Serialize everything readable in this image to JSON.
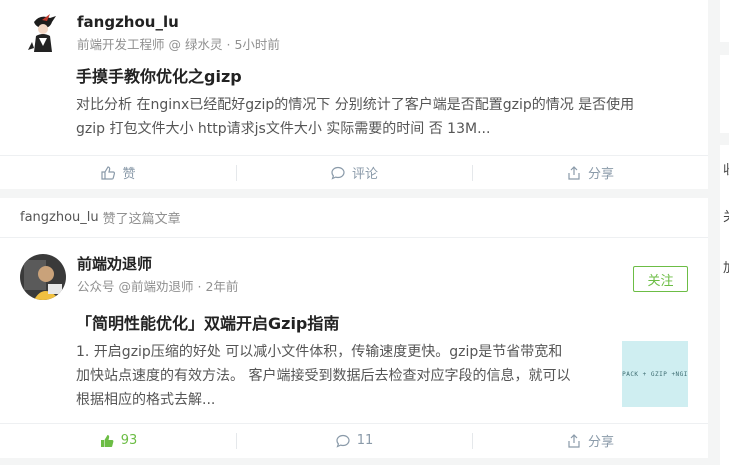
{
  "post1": {
    "author": "fangzhou_lu",
    "role": "前端开发工程师 @ 绿水灵",
    "time": "5小时前",
    "title": "手摸手教你优化之gizp",
    "summary_line1": "对比分析 在nginx已经配好gzip的情况下 分别统计了客户端是否配置gzip的情况 是否使用",
    "summary_line2": "gzip 打包文件大小 http请求js文件大小 实际需要的时间 否 13M...",
    "like_label": "赞",
    "comment_label": "评论",
    "share_label": "分享"
  },
  "activity": {
    "user": "fangzhou_lu",
    "action": "赞了这篇文章"
  },
  "post2": {
    "author": "前端劝退师",
    "role": "公众号 @前端劝退师",
    "time": "2年前",
    "follow_label": "关注",
    "title": "「简明性能优化」双端开启Gzip指南",
    "summary_line1": "1. 开启gzip压缩的好处 可以减小文件体积，传输速度更快。gzip是节省带宽和",
    "summary_line2": "加快站点速度的有效方法。 客户端接受到数据后去检查对应字段的信息，就可以",
    "summary_line3": "根据相应的格式去解...",
    "thumb_text": "PACK + GZIP +NGI",
    "like_count": "93",
    "comment_count": "11",
    "share_label": "分享"
  },
  "sidebar": {
    "char1": "收",
    "char2": "关",
    "char3": "加"
  },
  "colors": {
    "accent_green": "#6cbd45",
    "muted": "#909090",
    "action_gray": "#8a9aa9"
  }
}
